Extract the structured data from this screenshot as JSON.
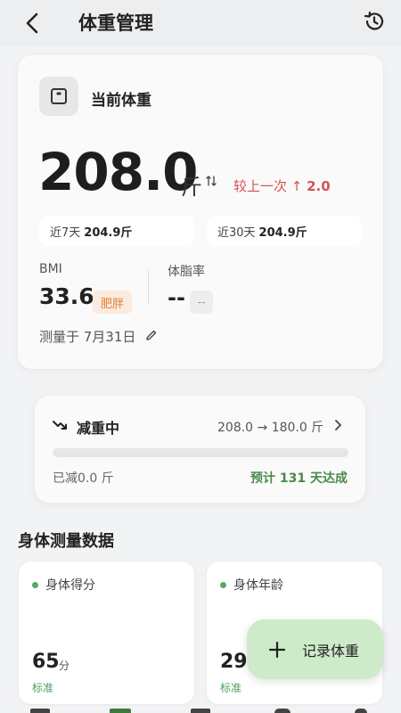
{
  "header": {
    "title": "体重管理",
    "back_icon": "chevron-left-icon",
    "history_icon": "history-icon"
  },
  "weight_card": {
    "title": "当前体重",
    "scale_icon": "scale-icon",
    "weight": "208.0",
    "unit": "斤",
    "delta_label": "较上一次 ↑",
    "delta_value": "2.0",
    "chip_7_label": "近7天",
    "chip_7_value": "204.9斤",
    "chip_30_label": "近30天",
    "chip_30_value": "204.9斤",
    "bmi_label": "BMI",
    "bmi_value": "33.6",
    "bmi_status": "肥胖",
    "bodyfat_label": "体脂率",
    "bodyfat_value": "--",
    "bodyfat_status": "--",
    "measured_text": "测量于 7月31日"
  },
  "goal_card": {
    "title": "减重中",
    "range": "208.0 → 180.0 斤",
    "progress": 0,
    "lost": "已减0.0 斤",
    "eta": "预计 131 天达成"
  },
  "body_section": {
    "title": "身体测量数据",
    "cards": [
      {
        "label": "身体得分",
        "value": "65",
        "unit": "分",
        "status": "标准"
      },
      {
        "label": "身体年龄",
        "value": "29",
        "unit": "",
        "status": "标准"
      }
    ]
  },
  "fab": {
    "label": "记录体重",
    "icon": "plus-icon"
  },
  "colors": {
    "accent_green": "#5aa05a",
    "delta_red": "#d9534f",
    "bmi_orange": "#e0823a",
    "fab_bg": "#cdebc9"
  }
}
